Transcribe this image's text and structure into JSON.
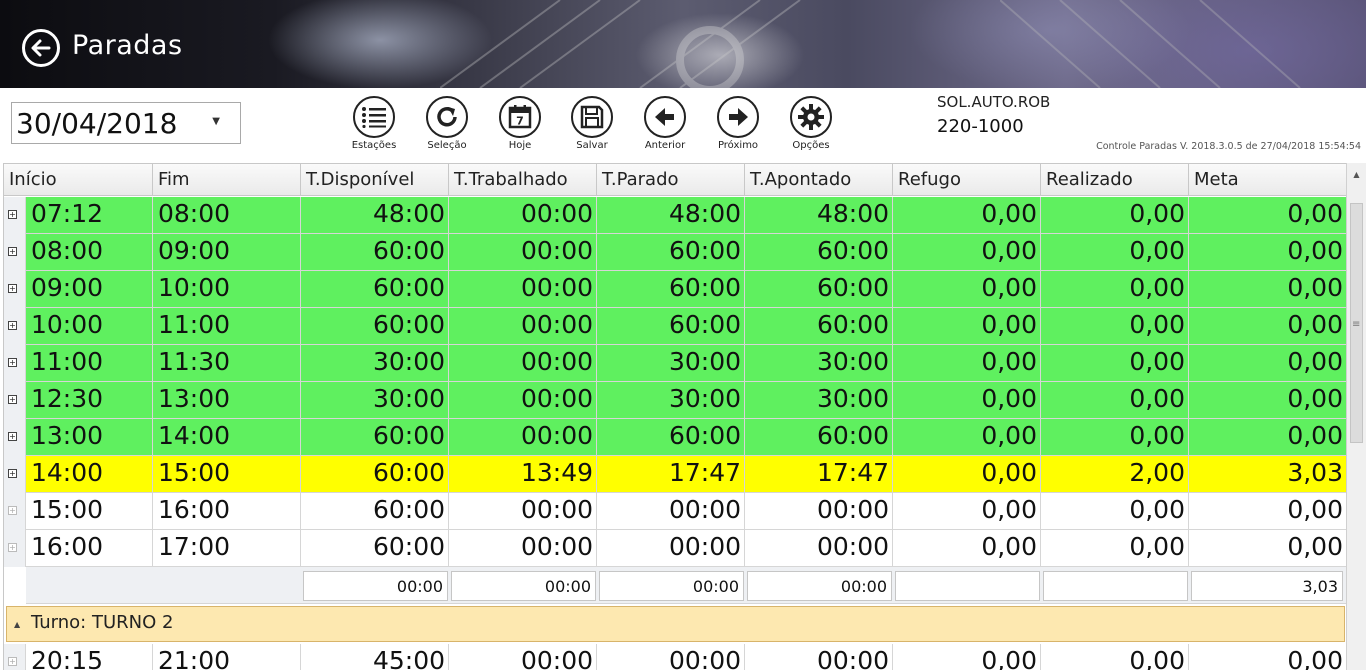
{
  "header": {
    "title": "Paradas"
  },
  "toolbar": {
    "date_value": "30/04/2018",
    "buttons": [
      {
        "label": "Estações",
        "icon": "list-icon"
      },
      {
        "label": "Seleção",
        "icon": "refresh-icon"
      },
      {
        "label": "Hoje",
        "icon": "calendar-icon"
      },
      {
        "label": "Salvar",
        "icon": "save-icon"
      },
      {
        "label": "Anterior",
        "icon": "arrow-left-icon"
      },
      {
        "label": "Próximo",
        "icon": "arrow-right-icon"
      },
      {
        "label": "Opções",
        "icon": "gear-icon"
      }
    ],
    "calendar_day": "7"
  },
  "station": {
    "name": "SOL.AUTO.ROB",
    "code": "220-1000"
  },
  "version_text": "Controle Paradas V. 2018.3.0.5 de 27/04/2018 15:54:54",
  "grid": {
    "columns": [
      "Início",
      "Fim",
      "T.Disponível",
      "T.Trabalhado",
      "T.Parado",
      "T.Apontado",
      "Refugo",
      "Realizado",
      "Meta"
    ],
    "rows": [
      {
        "status": "green",
        "cells": [
          "07:12",
          "08:00",
          "48:00",
          "00:00",
          "48:00",
          "48:00",
          "0,00",
          "0,00",
          "0,00"
        ]
      },
      {
        "status": "green",
        "cells": [
          "08:00",
          "09:00",
          "60:00",
          "00:00",
          "60:00",
          "60:00",
          "0,00",
          "0,00",
          "0,00"
        ]
      },
      {
        "status": "green",
        "cells": [
          "09:00",
          "10:00",
          "60:00",
          "00:00",
          "60:00",
          "60:00",
          "0,00",
          "0,00",
          "0,00"
        ]
      },
      {
        "status": "green",
        "cells": [
          "10:00",
          "11:00",
          "60:00",
          "00:00",
          "60:00",
          "60:00",
          "0,00",
          "0,00",
          "0,00"
        ]
      },
      {
        "status": "green",
        "cells": [
          "11:00",
          "11:30",
          "30:00",
          "00:00",
          "30:00",
          "30:00",
          "0,00",
          "0,00",
          "0,00"
        ]
      },
      {
        "status": "green",
        "cells": [
          "12:30",
          "13:00",
          "30:00",
          "00:00",
          "30:00",
          "30:00",
          "0,00",
          "0,00",
          "0,00"
        ]
      },
      {
        "status": "green",
        "cells": [
          "13:00",
          "14:00",
          "60:00",
          "00:00",
          "60:00",
          "60:00",
          "0,00",
          "0,00",
          "0,00"
        ]
      },
      {
        "status": "yellow",
        "cells": [
          "14:00",
          "15:00",
          "60:00",
          "13:49",
          "17:47",
          "17:47",
          "0,00",
          "2,00",
          "3,03"
        ]
      },
      {
        "status": "white",
        "cells": [
          "15:00",
          "16:00",
          "60:00",
          "00:00",
          "00:00",
          "00:00",
          "0,00",
          "0,00",
          "0,00"
        ]
      },
      {
        "status": "white",
        "cells": [
          "16:00",
          "17:00",
          "60:00",
          "00:00",
          "00:00",
          "00:00",
          "0,00",
          "0,00",
          "0,00"
        ]
      }
    ],
    "totals": [
      "00:00",
      "00:00",
      "00:00",
      "00:00",
      "",
      "",
      "3,03"
    ],
    "group_label": "Turno: TURNO 2",
    "next_row": {
      "status": "white",
      "cells": [
        "20:15",
        "21:00",
        "45:00",
        "00:00",
        "00:00",
        "00:00",
        "0,00",
        "0,00",
        "0,00"
      ]
    }
  },
  "colors": {
    "row_green": "#5ff05f",
    "row_yellow": "#ffff00",
    "group_bg": "#fde8b0"
  }
}
